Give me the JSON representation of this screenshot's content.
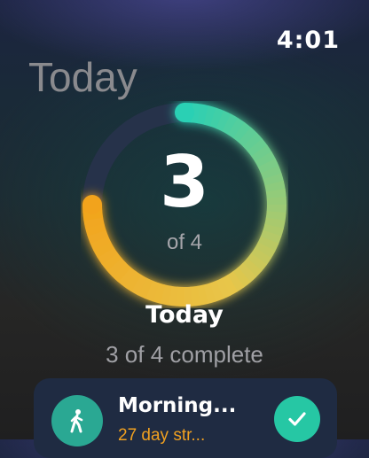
{
  "status_bar": {
    "time": "4:01"
  },
  "header": {
    "title": "Today"
  },
  "progress_ring": {
    "completed": "3",
    "of_total_label": "of 4",
    "fraction": 0.75,
    "colors": {
      "start": "#f2a31c",
      "middle": "#e8c64a",
      "end": "#2ad0b4",
      "track": "#26324a"
    }
  },
  "summary": {
    "title": "Today",
    "subtitle": "3 of 4 complete"
  },
  "habits": [
    {
      "name": "Morning...",
      "streak": "27 day str...",
      "icon": "walking-person-icon",
      "completed": true
    }
  ],
  "colors": {
    "accent_teal": "#26c7a4",
    "streak_orange": "#f0a020",
    "card_bg": "#1f2b42"
  }
}
